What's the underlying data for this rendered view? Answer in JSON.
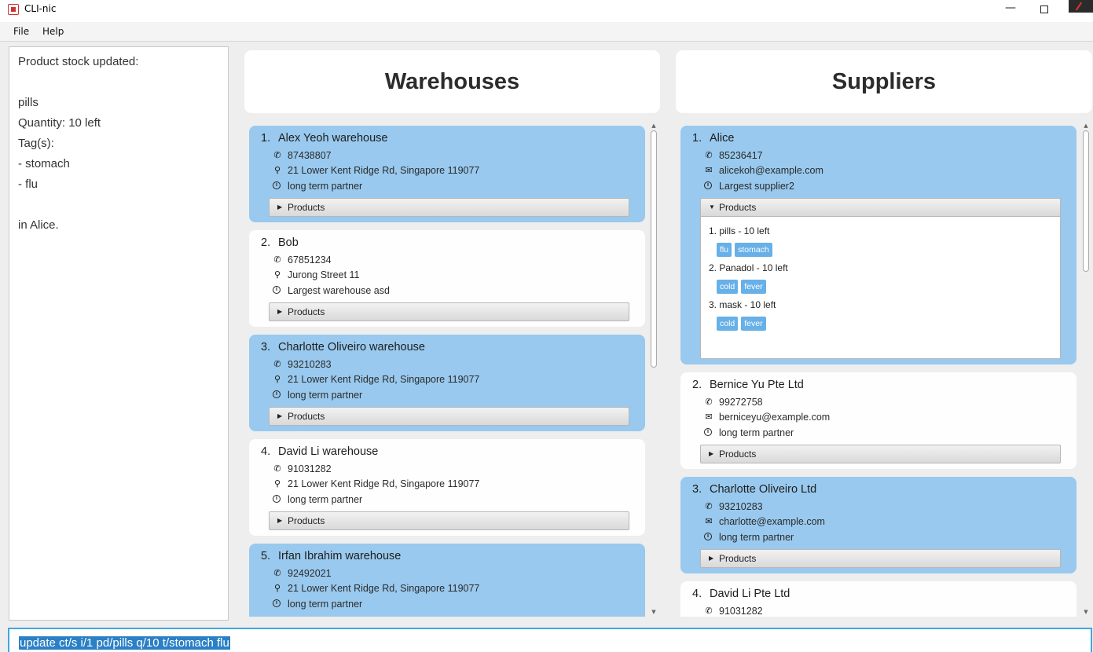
{
  "window": {
    "title": "CLI-nic",
    "minimize": "—"
  },
  "menu": {
    "file": "File",
    "help": "Help"
  },
  "result": {
    "lines": [
      "Product stock updated:",
      "",
      "pills",
      "Quantity: 10 left",
      "Tag(s):",
      "- stomach",
      "- flu",
      "",
      "in Alice."
    ]
  },
  "warehouses": {
    "title": "Warehouses",
    "products_label": "Products",
    "items": [
      {
        "index": "1.",
        "name": "Alex Yeoh warehouse",
        "phone": "87438807",
        "address": "21 Lower Kent Ridge Rd, Singapore 119077",
        "remark": "long term partner"
      },
      {
        "index": "2.",
        "name": "Bob",
        "phone": "67851234",
        "address": "Jurong Street 11",
        "remark": "Largest warehouse asd"
      },
      {
        "index": "3.",
        "name": "Charlotte Oliveiro warehouse",
        "phone": "93210283",
        "address": "21 Lower Kent Ridge Rd, Singapore 119077",
        "remark": "long term partner"
      },
      {
        "index": "4.",
        "name": "David Li warehouse",
        "phone": "91031282",
        "address": "21 Lower Kent Ridge Rd, Singapore 119077",
        "remark": "long term partner"
      },
      {
        "index": "5.",
        "name": "Irfan Ibrahim warehouse",
        "phone": "92492021",
        "address": "21 Lower Kent Ridge Rd, Singapore 119077",
        "remark": "long term partner"
      }
    ]
  },
  "suppliers": {
    "title": "Suppliers",
    "products_label": "Products",
    "items": [
      {
        "index": "1.",
        "name": "Alice",
        "phone": "85236417",
        "email": "alicekoh@example.com",
        "remark": "Largest supplier2",
        "products": [
          {
            "label": "1. pills - 10 left",
            "tags": [
              "flu",
              "stomach"
            ]
          },
          {
            "label": "2. Panadol - 10 left",
            "tags": [
              "cold",
              "fever"
            ]
          },
          {
            "label": "3. mask - 10 left",
            "tags": [
              "cold",
              "fever"
            ]
          }
        ]
      },
      {
        "index": "2.",
        "name": "Bernice Yu Pte Ltd",
        "phone": "99272758",
        "email": "berniceyu@example.com",
        "remark": "long term partner"
      },
      {
        "index": "3.",
        "name": "Charlotte Oliveiro Ltd",
        "phone": "93210283",
        "email": "charlotte@example.com",
        "remark": "long term partner"
      },
      {
        "index": "4.",
        "name": "David Li Pte Ltd",
        "phone": "91031282"
      }
    ]
  },
  "command": {
    "value": "update ct/s i/1 pd/pills q/10 t/stomach flu"
  }
}
